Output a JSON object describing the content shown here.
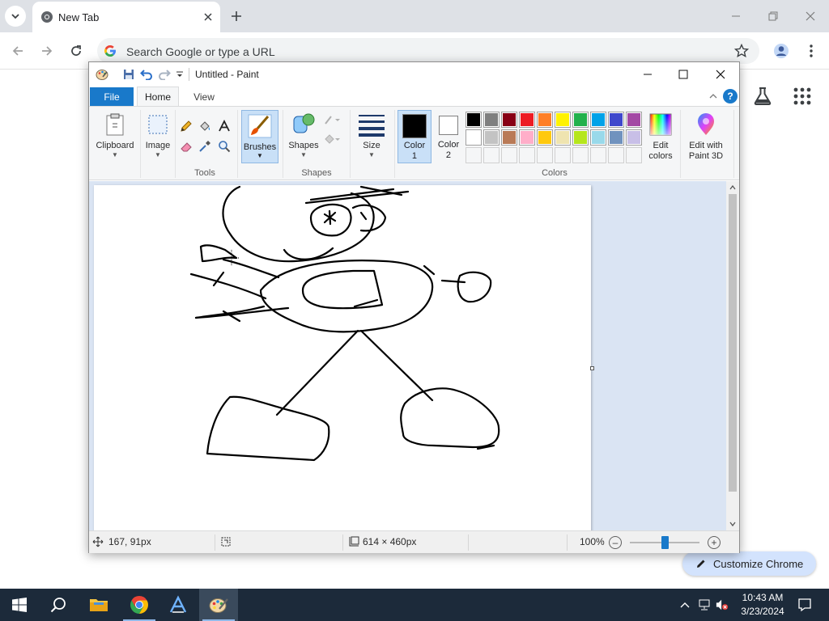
{
  "chrome": {
    "tab_title": "New Tab",
    "omnibox_placeholder": "Search Google or type a URL",
    "customize_label": "Customize Chrome"
  },
  "paint": {
    "title": "Untitled - Paint",
    "tabs": {
      "file": "File",
      "home": "Home",
      "view": "View"
    },
    "help": "?",
    "ribbon": {
      "clipboard": "Clipboard",
      "image": "Image",
      "tools": "Tools",
      "brushes": "Brushes",
      "shapes_btn": "Shapes",
      "shapes_group": "Shapes",
      "size": "Size",
      "color1": "Color\n1",
      "color2": "Color\n2",
      "edit_colors": "Edit\ncolors",
      "edit_paint3d": "Edit with\nPaint 3D",
      "colors_group": "Colors"
    },
    "colors": {
      "color1": "#000000",
      "color2": "#ffffff",
      "palette_row1": [
        "#000000",
        "#7f7f7f",
        "#880015",
        "#ed1c24",
        "#ff7f27",
        "#fff200",
        "#22b14c",
        "#00a2e8",
        "#3f48cc",
        "#a349a4"
      ],
      "palette_row2": [
        "#ffffff",
        "#c3c3c3",
        "#b97a57",
        "#ffaec9",
        "#ffc90e",
        "#efe4b0",
        "#b5e61d",
        "#99d9ea",
        "#7092be",
        "#c8bfe7"
      ]
    },
    "status": {
      "cursor_pos": "167, 91px",
      "selection_size": "",
      "canvas_size": "614 × 460px",
      "zoom": "100%"
    }
  },
  "taskbar": {
    "time": "10:43 AM",
    "date": "3/23/2024"
  }
}
